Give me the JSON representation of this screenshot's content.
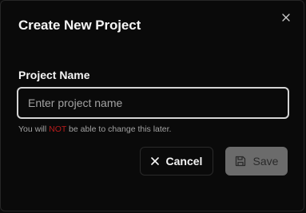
{
  "dialog": {
    "title": "Create New Project",
    "close_icon": "close-icon"
  },
  "form": {
    "label": "Project Name",
    "input_value": "",
    "input_placeholder": "Enter project name",
    "hint_before": "You will ",
    "hint_emphasis": "NOT",
    "hint_after": " be able to change this later."
  },
  "actions": {
    "cancel_label": "Cancel",
    "cancel_icon": "x-icon",
    "save_label": "Save",
    "save_icon": "save-icon"
  },
  "colors": {
    "background": "#0a0a0a",
    "text": "#f5f5f5",
    "muted": "#a3a3a3",
    "warning": "#b91c1c",
    "save_disabled_bg": "#6b6b6b"
  }
}
